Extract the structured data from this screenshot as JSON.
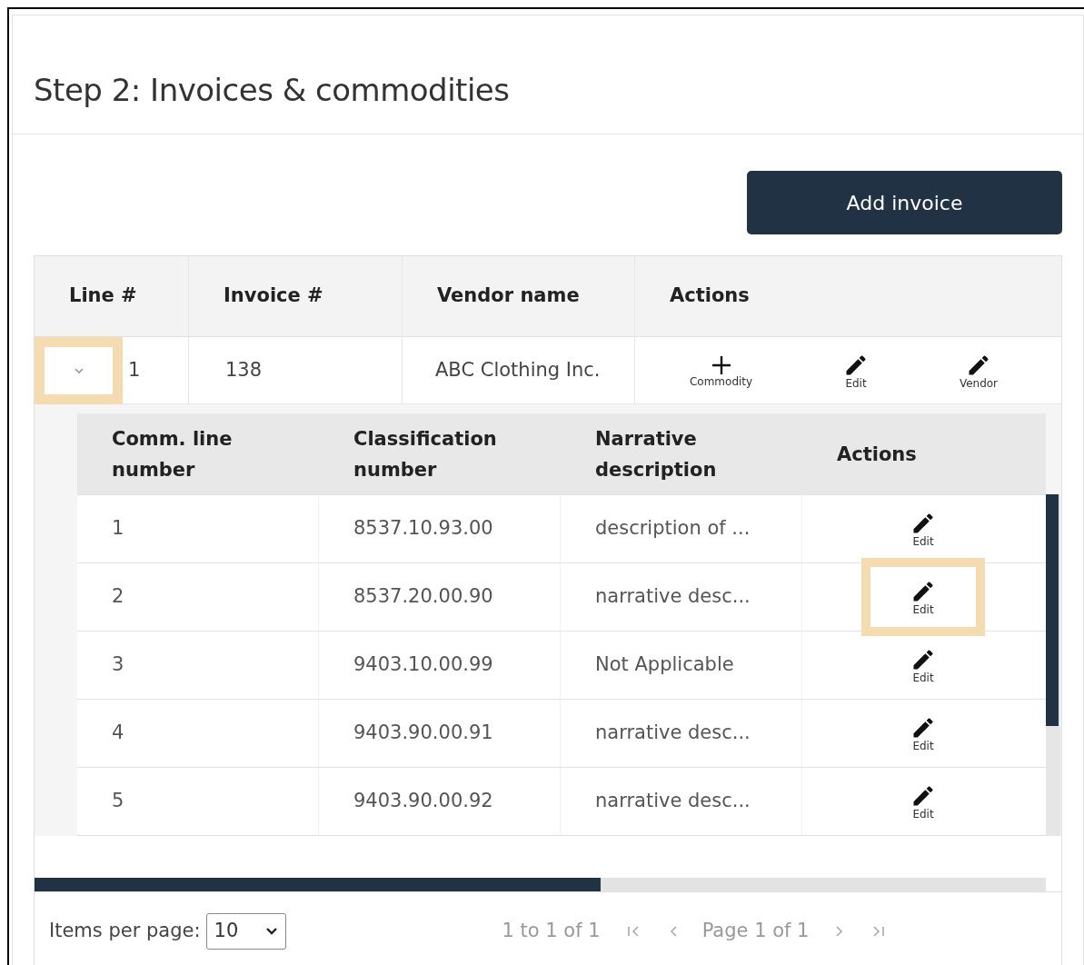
{
  "title": "Step 2: Invoices & commodities",
  "add_button": "Add invoice",
  "table": {
    "columns": [
      "Line #",
      "Invoice #",
      "Vendor name",
      "Actions"
    ],
    "rows": [
      {
        "expanded": true,
        "highlighted": true,
        "line": "1",
        "invoice": "138",
        "vendor": "ABC Clothing Inc.",
        "actions": [
          {
            "kind": "add",
            "label": "Commodity"
          },
          {
            "kind": "edit",
            "label": "Edit"
          },
          {
            "kind": "edit",
            "label": "Vendor"
          }
        ],
        "commodities": {
          "columns": [
            "Comm. line number",
            "Classification number",
            "Narrative description",
            "Actions"
          ],
          "rows": [
            {
              "number": "1",
              "classification": "8537.10.93.00",
              "narrative": "description of ...",
              "action": "Edit",
              "highlighted": false
            },
            {
              "number": "2",
              "classification": "8537.20.00.90",
              "narrative": "narrative desc...",
              "action": "Edit",
              "highlighted": true
            },
            {
              "number": "3",
              "classification": "9403.10.00.99",
              "narrative": "Not Applicable",
              "action": "Edit",
              "highlighted": false
            },
            {
              "number": "4",
              "classification": "9403.90.00.91",
              "narrative": "narrative desc...",
              "action": "Edit",
              "highlighted": false
            },
            {
              "number": "5",
              "classification": "9403.90.00.92",
              "narrative": "narrative desc...",
              "action": "Edit",
              "highlighted": false
            }
          ]
        }
      }
    ]
  },
  "pagination": {
    "items_per_page_label": "Items per page:",
    "items_per_page": "10",
    "range": "1 to 1 of 1",
    "page": "Page 1 of 1"
  }
}
